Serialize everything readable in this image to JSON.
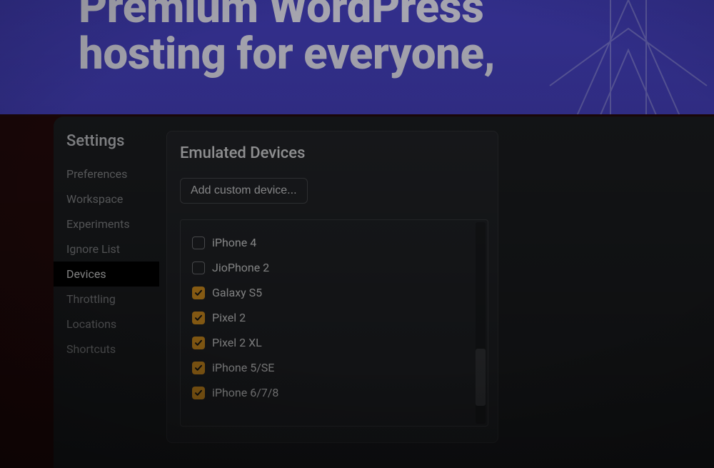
{
  "hero": {
    "headline_line1": "Premium WordPress",
    "headline_line2": "hosting for everyone,"
  },
  "settings": {
    "title": "Settings",
    "items": [
      {
        "label": "Preferences",
        "active": false
      },
      {
        "label": "Workspace",
        "active": false
      },
      {
        "label": "Experiments",
        "active": false
      },
      {
        "label": "Ignore List",
        "active": false
      },
      {
        "label": "Devices",
        "active": true
      },
      {
        "label": "Throttling",
        "active": false
      },
      {
        "label": "Locations",
        "active": false
      },
      {
        "label": "Shortcuts",
        "active": false
      }
    ]
  },
  "panel": {
    "title": "Emulated Devices",
    "add_button_label": "Add custom device...",
    "devices": [
      {
        "label": "iPhone 4",
        "checked": false
      },
      {
        "label": "JioPhone 2",
        "checked": false
      },
      {
        "label": "Galaxy S5",
        "checked": true
      },
      {
        "label": "Pixel 2",
        "checked": true
      },
      {
        "label": "Pixel 2 XL",
        "checked": true
      },
      {
        "label": "iPhone 5/SE",
        "checked": true
      },
      {
        "label": "iPhone 6/7/8",
        "checked": true
      }
    ]
  },
  "colors": {
    "accent_checkbox": "#f5a623",
    "hero_bg": "#4843c8"
  }
}
